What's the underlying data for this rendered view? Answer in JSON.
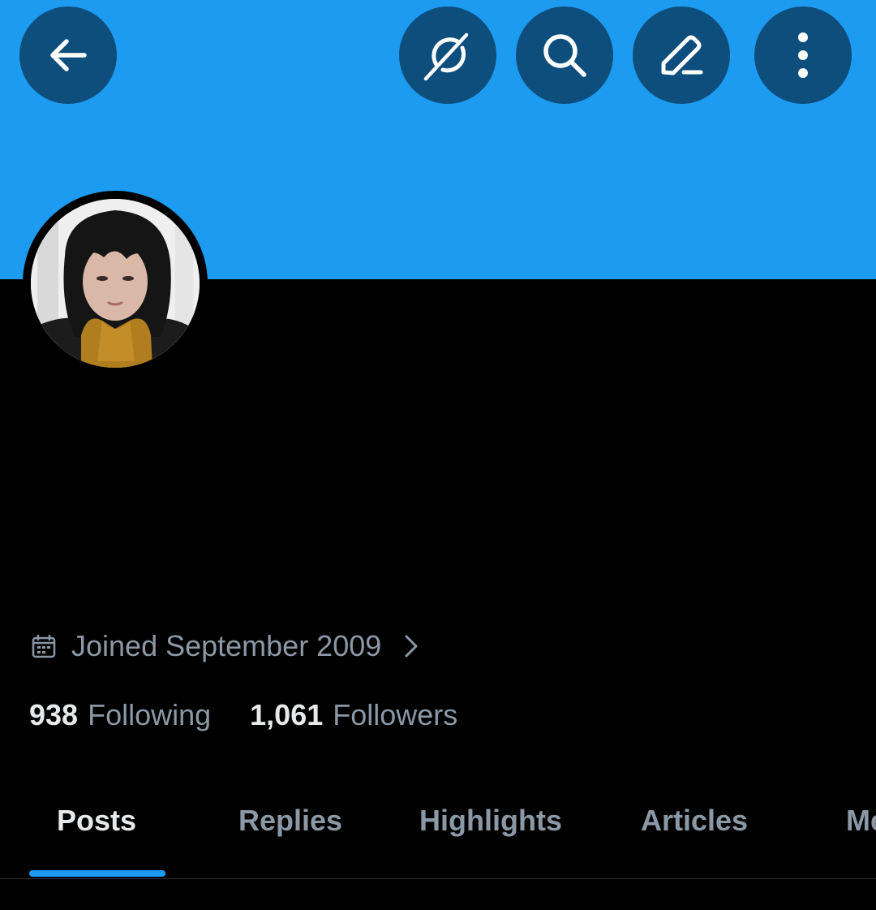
{
  "colors": {
    "banner": "#1d9bf0",
    "button_bg": "#0e4e7c",
    "primary_text": "#e7e9ea",
    "secondary_text": "#8b98a5",
    "accent": "#1d9bf0",
    "background": "#000000"
  },
  "header": {
    "icons": [
      "back-arrow-icon",
      "grok-icon",
      "search-icon",
      "edit-pencil-icon",
      "more-vertical-icon"
    ]
  },
  "profile": {
    "joined": "Joined September 2009",
    "following_count": "938",
    "following_label": "Following",
    "followers_count": "1,061",
    "followers_label": "Followers"
  },
  "tabs": [
    {
      "label": "Posts",
      "active": true
    },
    {
      "label": "Replies",
      "active": false
    },
    {
      "label": "Highlights",
      "active": false
    },
    {
      "label": "Articles",
      "active": false
    },
    {
      "label": "Media",
      "active": false
    }
  ]
}
